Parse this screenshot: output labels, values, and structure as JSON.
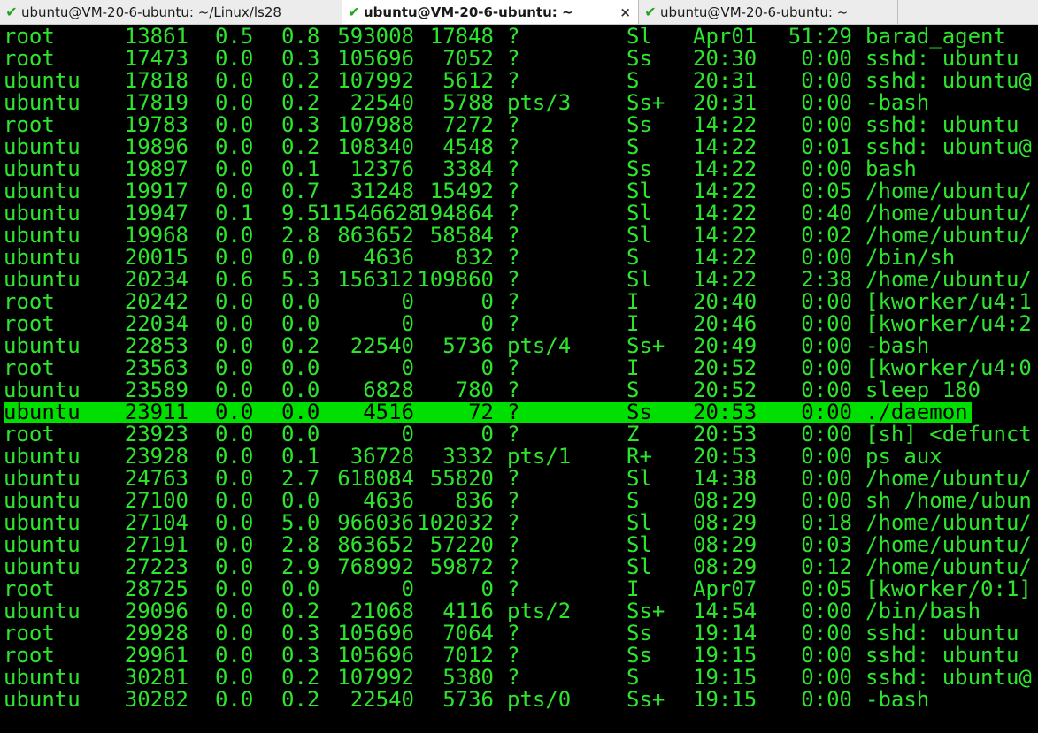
{
  "tabs": [
    {
      "title": "ubuntu@VM-20-6-ubuntu: ~/Linux/ls28",
      "status_icon": "check-icon",
      "active": false
    },
    {
      "title": "ubuntu@VM-20-6-ubuntu: ~",
      "status_icon": "check-icon",
      "active": true,
      "close_label": "×"
    },
    {
      "title": "ubuntu@VM-20-6-ubuntu: ~",
      "status_icon": "check-icon",
      "active": false
    }
  ],
  "colors": {
    "terminal_bg": "#000000",
    "terminal_fg": "#2ee52e",
    "highlight_bg": "#00e000",
    "highlight_fg": "#000000",
    "tab_check": "#1fa51f"
  },
  "terminal": {
    "highlighted_row_index": 17,
    "rows": [
      {
        "user": "root",
        "pid": "13861",
        "cpu": "0.5",
        "mem": "0.8",
        "vsz": "593008",
        "rss": "17848",
        "tty": "?",
        "stat": "Sl",
        "start": "Apr01",
        "time": "51:29",
        "cmd": "barad_agent"
      },
      {
        "user": "root",
        "pid": "17473",
        "cpu": "0.0",
        "mem": "0.3",
        "vsz": "105696",
        "rss": "7052",
        "tty": "?",
        "stat": "Ss",
        "start": "20:30",
        "time": "0:00",
        "cmd": "sshd: ubuntu"
      },
      {
        "user": "ubuntu",
        "pid": "17818",
        "cpu": "0.0",
        "mem": "0.2",
        "vsz": "107992",
        "rss": "5612",
        "tty": "?",
        "stat": "S",
        "start": "20:31",
        "time": "0:00",
        "cmd": "sshd: ubuntu@"
      },
      {
        "user": "ubuntu",
        "pid": "17819",
        "cpu": "0.0",
        "mem": "0.2",
        "vsz": "22540",
        "rss": "5788",
        "tty": "pts/3",
        "stat": "Ss+",
        "start": "20:31",
        "time": "0:00",
        "cmd": "-bash"
      },
      {
        "user": "root",
        "pid": "19783",
        "cpu": "0.0",
        "mem": "0.3",
        "vsz": "107988",
        "rss": "7272",
        "tty": "?",
        "stat": "Ss",
        "start": "14:22",
        "time": "0:00",
        "cmd": "sshd: ubuntu"
      },
      {
        "user": "ubuntu",
        "pid": "19896",
        "cpu": "0.0",
        "mem": "0.2",
        "vsz": "108340",
        "rss": "4548",
        "tty": "?",
        "stat": "S",
        "start": "14:22",
        "time": "0:01",
        "cmd": "sshd: ubuntu@"
      },
      {
        "user": "ubuntu",
        "pid": "19897",
        "cpu": "0.0",
        "mem": "0.1",
        "vsz": "12376",
        "rss": "3384",
        "tty": "?",
        "stat": "Ss",
        "start": "14:22",
        "time": "0:00",
        "cmd": "bash"
      },
      {
        "user": "ubuntu",
        "pid": "19917",
        "cpu": "0.0",
        "mem": "0.7",
        "vsz": "31248",
        "rss": "15492",
        "tty": "?",
        "stat": "Sl",
        "start": "14:22",
        "time": "0:05",
        "cmd": "/home/ubuntu/"
      },
      {
        "user": "ubuntu",
        "pid": "19947",
        "cpu": "0.1",
        "mem": "9.5",
        "vsz": "11546628",
        "rss": "194864",
        "tty": "?",
        "stat": "Sl",
        "start": "14:22",
        "time": "0:40",
        "cmd": "/home/ubuntu/"
      },
      {
        "user": "ubuntu",
        "pid": "19968",
        "cpu": "0.0",
        "mem": "2.8",
        "vsz": "863652",
        "rss": "58584",
        "tty": "?",
        "stat": "Sl",
        "start": "14:22",
        "time": "0:02",
        "cmd": "/home/ubuntu/"
      },
      {
        "user": "ubuntu",
        "pid": "20015",
        "cpu": "0.0",
        "mem": "0.0",
        "vsz": "4636",
        "rss": "832",
        "tty": "?",
        "stat": "S",
        "start": "14:22",
        "time": "0:00",
        "cmd": "/bin/sh"
      },
      {
        "user": "ubuntu",
        "pid": "20234",
        "cpu": "0.6",
        "mem": "5.3",
        "vsz": "156312",
        "rss": "109860",
        "tty": "?",
        "stat": "Sl",
        "start": "14:22",
        "time": "2:38",
        "cmd": "/home/ubuntu/"
      },
      {
        "user": "root",
        "pid": "20242",
        "cpu": "0.0",
        "mem": "0.0",
        "vsz": "0",
        "rss": "0",
        "tty": "?",
        "stat": "I",
        "start": "20:40",
        "time": "0:00",
        "cmd": "[kworker/u4:1"
      },
      {
        "user": "root",
        "pid": "22034",
        "cpu": "0.0",
        "mem": "0.0",
        "vsz": "0",
        "rss": "0",
        "tty": "?",
        "stat": "I",
        "start": "20:46",
        "time": "0:00",
        "cmd": "[kworker/u4:2"
      },
      {
        "user": "ubuntu",
        "pid": "22853",
        "cpu": "0.0",
        "mem": "0.2",
        "vsz": "22540",
        "rss": "5736",
        "tty": "pts/4",
        "stat": "Ss+",
        "start": "20:49",
        "time": "0:00",
        "cmd": "-bash"
      },
      {
        "user": "root",
        "pid": "23563",
        "cpu": "0.0",
        "mem": "0.0",
        "vsz": "0",
        "rss": "0",
        "tty": "?",
        "stat": "I",
        "start": "20:52",
        "time": "0:00",
        "cmd": "[kworker/u4:0"
      },
      {
        "user": "ubuntu",
        "pid": "23589",
        "cpu": "0.0",
        "mem": "0.0",
        "vsz": "6828",
        "rss": "780",
        "tty": "?",
        "stat": "S",
        "start": "20:52",
        "time": "0:00",
        "cmd": "sleep 180"
      },
      {
        "user": "ubuntu",
        "pid": "23911",
        "cpu": "0.0",
        "mem": "0.0",
        "vsz": "4516",
        "rss": "72",
        "tty": "?",
        "stat": "Ss",
        "start": "20:53",
        "time": "0:00",
        "cmd": "./daemon"
      },
      {
        "user": "root",
        "pid": "23923",
        "cpu": "0.0",
        "mem": "0.0",
        "vsz": "0",
        "rss": "0",
        "tty": "?",
        "stat": "Z",
        "start": "20:53",
        "time": "0:00",
        "cmd": "[sh] <defunct"
      },
      {
        "user": "ubuntu",
        "pid": "23928",
        "cpu": "0.0",
        "mem": "0.1",
        "vsz": "36728",
        "rss": "3332",
        "tty": "pts/1",
        "stat": "R+",
        "start": "20:53",
        "time": "0:00",
        "cmd": "ps aux"
      },
      {
        "user": "ubuntu",
        "pid": "24763",
        "cpu": "0.0",
        "mem": "2.7",
        "vsz": "618084",
        "rss": "55820",
        "tty": "?",
        "stat": "Sl",
        "start": "14:38",
        "time": "0:00",
        "cmd": "/home/ubuntu/"
      },
      {
        "user": "ubuntu",
        "pid": "27100",
        "cpu": "0.0",
        "mem": "0.0",
        "vsz": "4636",
        "rss": "836",
        "tty": "?",
        "stat": "S",
        "start": "08:29",
        "time": "0:00",
        "cmd": "sh /home/ubun"
      },
      {
        "user": "ubuntu",
        "pid": "27104",
        "cpu": "0.0",
        "mem": "5.0",
        "vsz": "966036",
        "rss": "102032",
        "tty": "?",
        "stat": "Sl",
        "start": "08:29",
        "time": "0:18",
        "cmd": "/home/ubuntu/"
      },
      {
        "user": "ubuntu",
        "pid": "27191",
        "cpu": "0.0",
        "mem": "2.8",
        "vsz": "863652",
        "rss": "57220",
        "tty": "?",
        "stat": "Sl",
        "start": "08:29",
        "time": "0:03",
        "cmd": "/home/ubuntu/"
      },
      {
        "user": "ubuntu",
        "pid": "27223",
        "cpu": "0.0",
        "mem": "2.9",
        "vsz": "768992",
        "rss": "59872",
        "tty": "?",
        "stat": "Sl",
        "start": "08:29",
        "time": "0:12",
        "cmd": "/home/ubuntu/"
      },
      {
        "user": "root",
        "pid": "28725",
        "cpu": "0.0",
        "mem": "0.0",
        "vsz": "0",
        "rss": "0",
        "tty": "?",
        "stat": "I",
        "start": "Apr07",
        "time": "0:05",
        "cmd": "[kworker/0:1]"
      },
      {
        "user": "ubuntu",
        "pid": "29096",
        "cpu": "0.0",
        "mem": "0.2",
        "vsz": "21068",
        "rss": "4116",
        "tty": "pts/2",
        "stat": "Ss+",
        "start": "14:54",
        "time": "0:00",
        "cmd": "/bin/bash"
      },
      {
        "user": "root",
        "pid": "29928",
        "cpu": "0.0",
        "mem": "0.3",
        "vsz": "105696",
        "rss": "7064",
        "tty": "?",
        "stat": "Ss",
        "start": "19:14",
        "time": "0:00",
        "cmd": "sshd: ubuntu"
      },
      {
        "user": "root",
        "pid": "29961",
        "cpu": "0.0",
        "mem": "0.3",
        "vsz": "105696",
        "rss": "7012",
        "tty": "?",
        "stat": "Ss",
        "start": "19:15",
        "time": "0:00",
        "cmd": "sshd: ubuntu"
      },
      {
        "user": "ubuntu",
        "pid": "30281",
        "cpu": "0.0",
        "mem": "0.2",
        "vsz": "107992",
        "rss": "5380",
        "tty": "?",
        "stat": "S",
        "start": "19:15",
        "time": "0:00",
        "cmd": "sshd: ubuntu@"
      },
      {
        "user": "ubuntu",
        "pid": "30282",
        "cpu": "0.0",
        "mem": "0.2",
        "vsz": "22540",
        "rss": "5736",
        "tty": "pts/0",
        "stat": "Ss+",
        "start": "19:15",
        "time": "0:00",
        "cmd": "-bash"
      }
    ]
  }
}
